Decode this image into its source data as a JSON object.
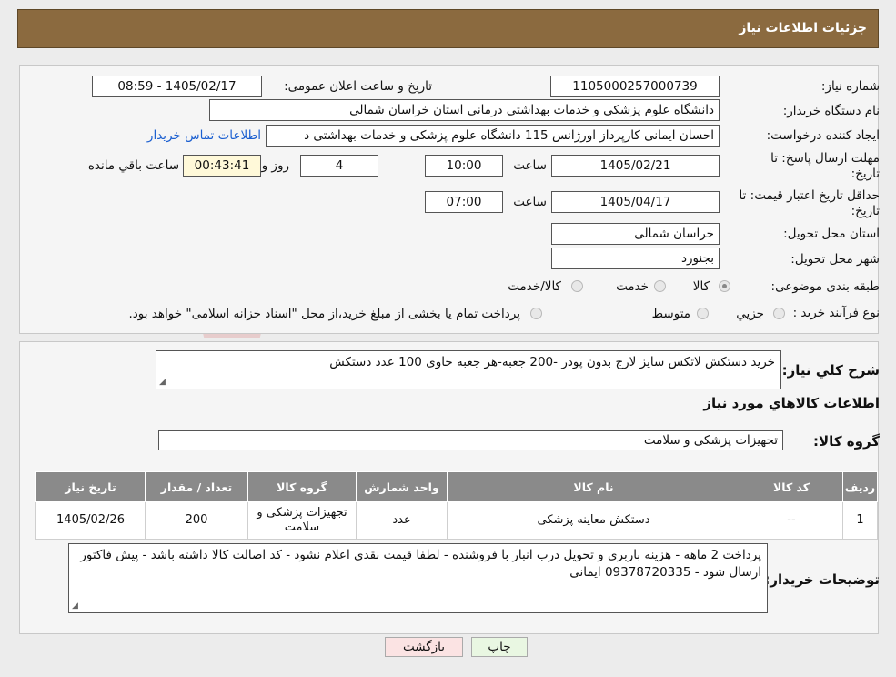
{
  "header": {
    "title": "جزئیات اطلاعات نیاز"
  },
  "form": {
    "need_number_label": "شماره نیاز:",
    "need_number": "1105000257000739",
    "announce_label": "تاریخ و ساعت اعلان عمومی:",
    "announce_value": "1405/02/17 - 08:59",
    "buyer_org_label": "نام دستگاه خریدار:",
    "buyer_org": "دانشگاه علوم پزشکی و خدمات بهداشتی درمانی استان خراسان شمالی",
    "requester_label": "ایجاد کننده درخواست:",
    "requester": "احسان ایمانی کارپرداز اورژانس 115 دانشگاه علوم پزشکی و خدمات بهداشتی د",
    "contact_link": "اطلاعات تماس خریدار",
    "deadline_label_1": "مهلت ارسال پاسخ: تا",
    "deadline_label_2": "تاریخ:",
    "deadline_date": "1405/02/21",
    "time_label": "ساعت",
    "deadline_time": "10:00",
    "days_value": "4",
    "days_label": "روز و",
    "remaining_value": "00:43:41",
    "remaining_label": "ساعت باقي مانده",
    "validity_label_1": "حداقل تاریخ اعتبار قیمت: تا",
    "validity_label_2": "تاریخ:",
    "validity_date": "1405/04/17",
    "validity_time": "07:00",
    "province_label": "استان محل تحویل:",
    "province": "خراسان شمالی",
    "city_label": "شهر محل تحویل:",
    "city": "بجنورد",
    "category_label": "طبقه بندی موضوعی:",
    "category_options": [
      "کالا",
      "خدمت",
      "کالا/خدمت"
    ],
    "process_label": "نوع فرآیند خرید :",
    "process_options": [
      "جزیي",
      "متوسط"
    ],
    "process_note": "پرداخت تمام یا بخشی از مبلغ خرید،از محل \"اسناد خزانه اسلامی\" خواهد بود."
  },
  "summary": {
    "label": "شرح کلي نياز:",
    "text": "خرید دستکش لاتکس سایز لارج بدون پودر -200 جعبه-هر جعبه حاوی 100 عدد دستکش",
    "goods_info_title": "اطلاعات کالاهاي مورد نياز",
    "group_label": "گروه کالا:",
    "group_value": "تجهیزات پزشکی و سلامت"
  },
  "table": {
    "headers": [
      "رديف",
      "کد کالا",
      "نام کالا",
      "واحد شمارش",
      "گروه کالا",
      "تعداد / مقدار",
      "تاریخ نیاز"
    ],
    "rows": [
      [
        "1",
        "--",
        "دستکش معاینه پزشکی",
        "عدد",
        "تجهیزات پزشکی و سلامت",
        "200",
        "1405/02/26"
      ]
    ]
  },
  "buyer_notes": {
    "label": "توضیحات خریدار:",
    "text": "پرداخت 2 ماهه - هزینه باربری و تحویل درب انبار با فروشنده - لطفا قیمت نقدی اعلام نشود - کد اصالت کالا داشته باشد - پیش فاکتور ارسال شود - 09378720335 ایمانی"
  },
  "buttons": {
    "print": "چاپ",
    "back": "بازگشت"
  },
  "colors": {
    "header_bg": "#8b6a3f",
    "table_header_bg": "#8a8a8a",
    "link": "#1b5fd0",
    "print_btn": "#e9f7e2",
    "back_btn": "#fbe3e3"
  }
}
